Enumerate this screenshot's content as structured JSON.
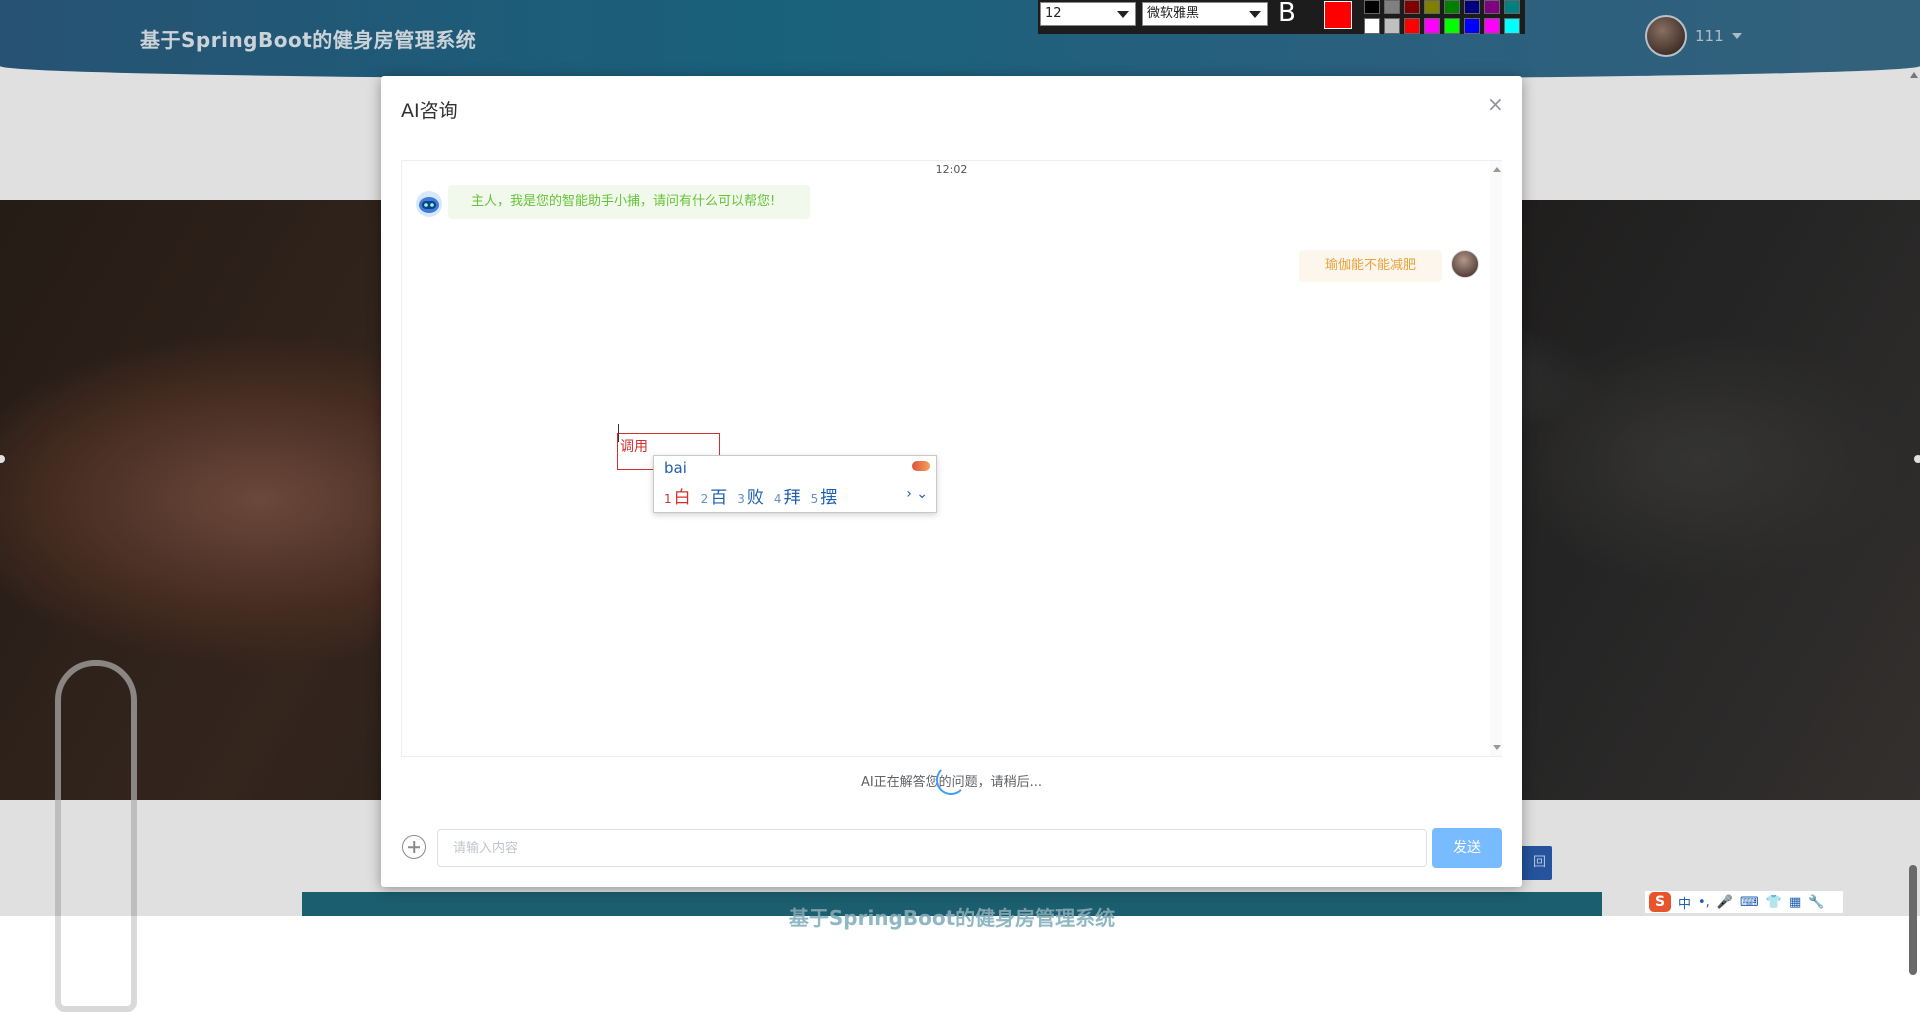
{
  "site": {
    "title": "基于SpringBoot的健身房管理系统",
    "username": "111"
  },
  "background": {
    "back_button_fragment": "回",
    "footer_text": "基于SpringBoot的健身房管理系统"
  },
  "dialog": {
    "title": "AI咨询",
    "close_symbol": "×",
    "chat": {
      "time": "12:02",
      "messages": [
        {
          "from": "bot",
          "text": "主人，我是您的智能助手小捕，请问有什么可以帮您!"
        },
        {
          "from": "user",
          "text": "瑜伽能不能减肥"
        }
      ]
    },
    "status": "AI正在解答您的问题，请稍后...",
    "input": {
      "placeholder": "请输入内容",
      "value": ""
    },
    "send_label": "发送"
  },
  "annotation": {
    "text": "调用",
    "color": "#d32f2f"
  },
  "ime": {
    "pinyin": "bai",
    "candidates": [
      {
        "num": "1",
        "char": "白"
      },
      {
        "num": "2",
        "char": "百"
      },
      {
        "num": "3",
        "char": "败"
      },
      {
        "num": "4",
        "char": "拜"
      },
      {
        "num": "5",
        "char": "摆"
      }
    ],
    "nav": "› ⌄"
  },
  "drawing_toolbar": {
    "font_size": "12",
    "font_name": "微软雅黑",
    "bold_label": "B",
    "current_color": "#ff0000",
    "palette_row1": [
      "#000000",
      "#808080",
      "#800000",
      "#808000",
      "#008000",
      "#000080",
      "#800080",
      "#008080"
    ],
    "palette_row2": [
      "#ffffff",
      "#c0c0c0",
      "#ff0000",
      "#ff00ff",
      "#00ff00",
      "#0000ff",
      "#ff00ff",
      "#00ffff"
    ]
  },
  "ime_tray": {
    "logo": "S",
    "items": [
      "中",
      "•,",
      "🎤",
      "⌨",
      "👕",
      "▦",
      "🔧"
    ]
  },
  "colors": {
    "accent": "#409eff",
    "send_button": "#79bbff",
    "bot_bubble": "#f0f9eb",
    "bot_text": "#67c23a",
    "user_bubble": "#fdf6ec",
    "user_text": "#e6a23c"
  }
}
